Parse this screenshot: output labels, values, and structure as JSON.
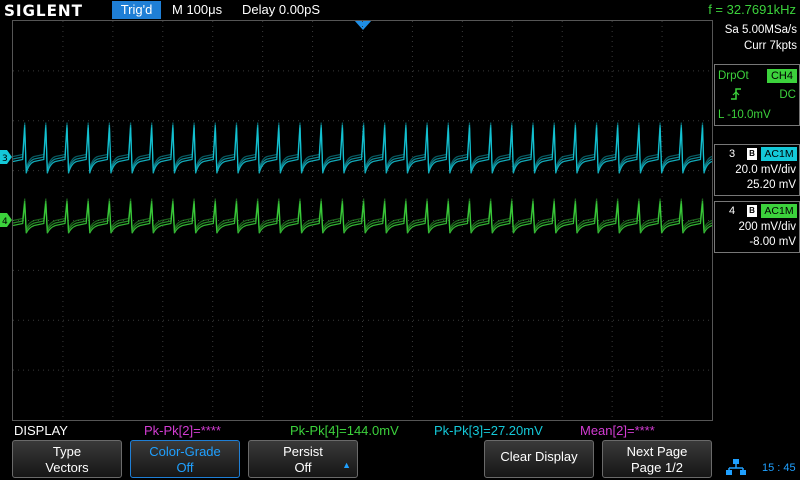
{
  "header": {
    "brand": "SIGLENT",
    "trigger_status": "Trig'd",
    "timebase": "M 100μs",
    "delay": "Delay 0.00pS",
    "frequency": "f = 32.7691kHz"
  },
  "acquisition": {
    "sample_rate": "Sa 5.00MSa/s",
    "memory": "Curr 7kpts"
  },
  "trigger": {
    "mode": "DrpOt",
    "source": "CH4",
    "coupling": "DC",
    "level": "L  -10.0mV"
  },
  "channels": [
    {
      "number": "3",
      "bw_label": "B",
      "coupling": "AC1M",
      "scale": "20.0 mV/div",
      "offset": "25.20 mV",
      "color": "#14c8d8"
    },
    {
      "number": "4",
      "bw_label": "B",
      "coupling": "AC1M",
      "scale": "200 mV/div",
      "offset": "-8.00 mV",
      "color": "#3cd23c"
    }
  ],
  "measurements": {
    "menu_title": "DISPLAY",
    "items": [
      "Pk-Pk[2]=****",
      "Pk-Pk[4]=144.0mV",
      "Pk-Pk[3]=27.20mV",
      "Mean[2]=****"
    ]
  },
  "softkeys": [
    {
      "line1": "Type",
      "line2": "Vectors"
    },
    {
      "line1": "Color-Grade",
      "line2": "Off"
    },
    {
      "line1": "Persist",
      "line2": "Off"
    },
    {
      "line1": "Clear Display"
    },
    {
      "line1": "Next Page",
      "line2": "Page 1/2"
    }
  ],
  "status": {
    "clock": "15 : 45"
  },
  "waveforms": {
    "ch3_color": "#14c8d8",
    "ch4_color": "#3cd23c",
    "cycles_on_screen": 33
  }
}
